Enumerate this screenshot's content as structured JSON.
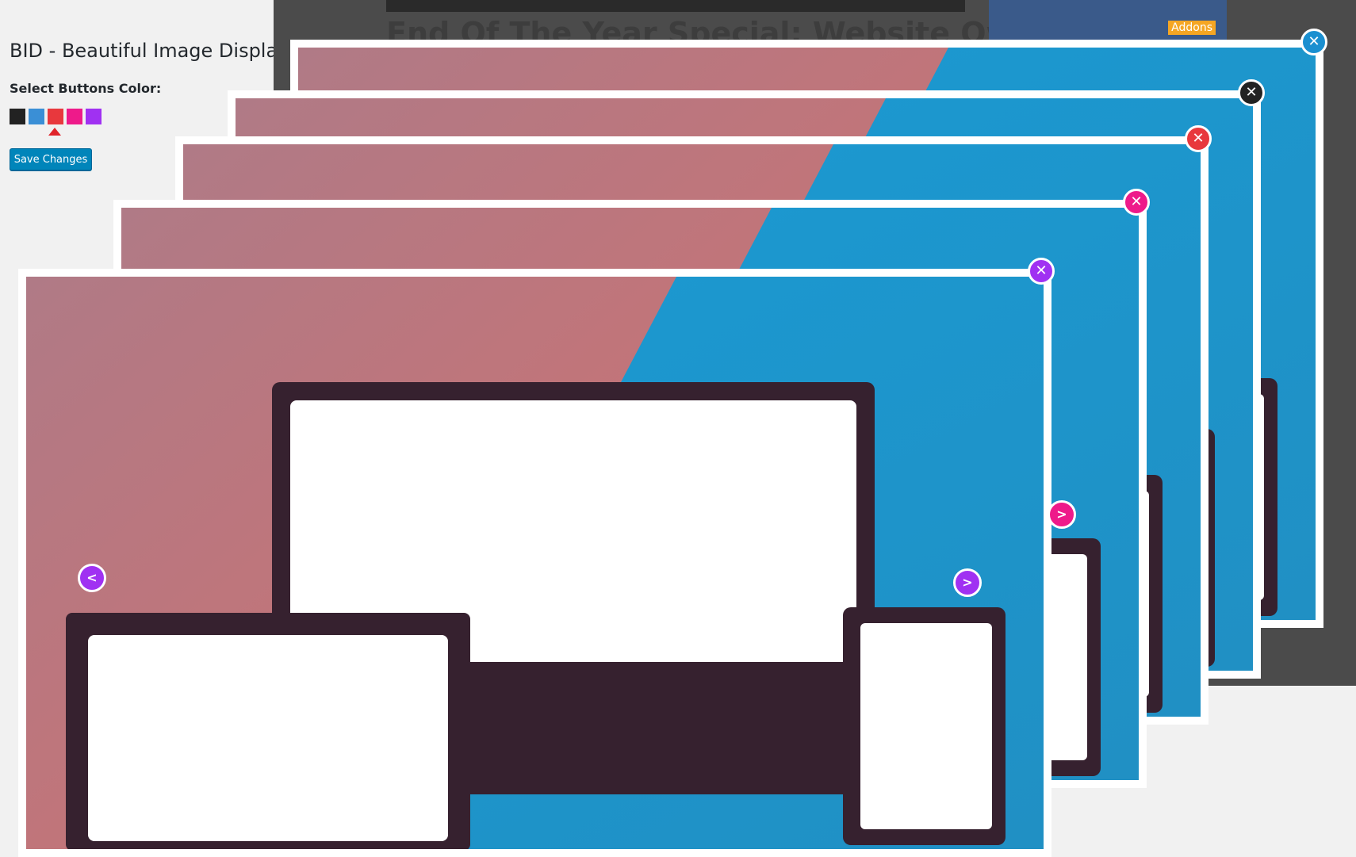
{
  "panel": {
    "title": "BID - Beautiful Image Display",
    "select_label": "Select Buttons Color:",
    "save_label": "Save Changes",
    "colors": [
      "#222222",
      "#3a8fd6",
      "#e8383d",
      "#ee1a8a",
      "#a031f2"
    ],
    "selected_color_index": 2
  },
  "background_page": {
    "title": "End Of The Year Special: Website Owners",
    "thumb_label": "Addons"
  },
  "popups": [
    {
      "close_color": "#1a8fd0",
      "close_glyph": "✕"
    },
    {
      "close_color": "#222222",
      "close_glyph": "✕"
    },
    {
      "close_color": "#e8383d",
      "close_glyph": "✕"
    },
    {
      "close_color": "#ee1a8a",
      "close_glyph": "✕",
      "next_glyph": ">"
    },
    {
      "close_color": "#a031f2",
      "close_glyph": "✕",
      "prev_glyph": "<",
      "next_glyph": ">"
    }
  ]
}
